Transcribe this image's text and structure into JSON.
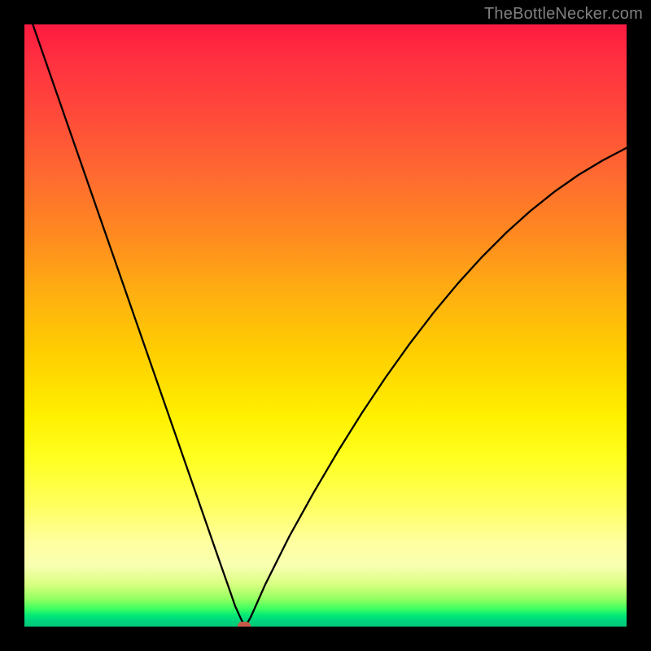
{
  "watermark": "TheBottleNecker.com",
  "colors": {
    "background": "#000000",
    "curve": "#000000",
    "marker": "#c95a4a"
  },
  "chart_data": {
    "type": "line",
    "title": "",
    "xlabel": "",
    "ylabel": "",
    "xlim": [
      0,
      100
    ],
    "ylim": [
      0,
      100
    ],
    "gradient_stops": [
      {
        "pos": 0,
        "color": "#ff1a40"
      },
      {
        "pos": 25,
        "color": "#ff6a30"
      },
      {
        "pos": 55,
        "color": "#ffd000"
      },
      {
        "pos": 80,
        "color": "#ffff60"
      },
      {
        "pos": 95,
        "color": "#90ff60"
      },
      {
        "pos": 100,
        "color": "#00c878"
      }
    ],
    "series": [
      {
        "name": "bottleneck-curve",
        "x": [
          0,
          4,
          8,
          12,
          16,
          20,
          24,
          28,
          32,
          34,
          35,
          36,
          36.5,
          37,
          37.5,
          38,
          40,
          44,
          48,
          52,
          56,
          60,
          64,
          68,
          72,
          76,
          80,
          84,
          88,
          92,
          96,
          100
        ],
        "y": [
          104,
          92.5,
          81,
          69.5,
          58,
          46.5,
          35,
          23.5,
          12,
          6.3,
          3.4,
          1.2,
          0.3,
          0.6,
          1.4,
          2.5,
          7,
          15,
          22.2,
          29,
          35.4,
          41.4,
          47,
          52.2,
          57,
          61.4,
          65.4,
          69,
          72.2,
          75,
          77.4,
          79.5
        ]
      }
    ],
    "marker": {
      "x": 36.5,
      "y": 0.2
    }
  }
}
